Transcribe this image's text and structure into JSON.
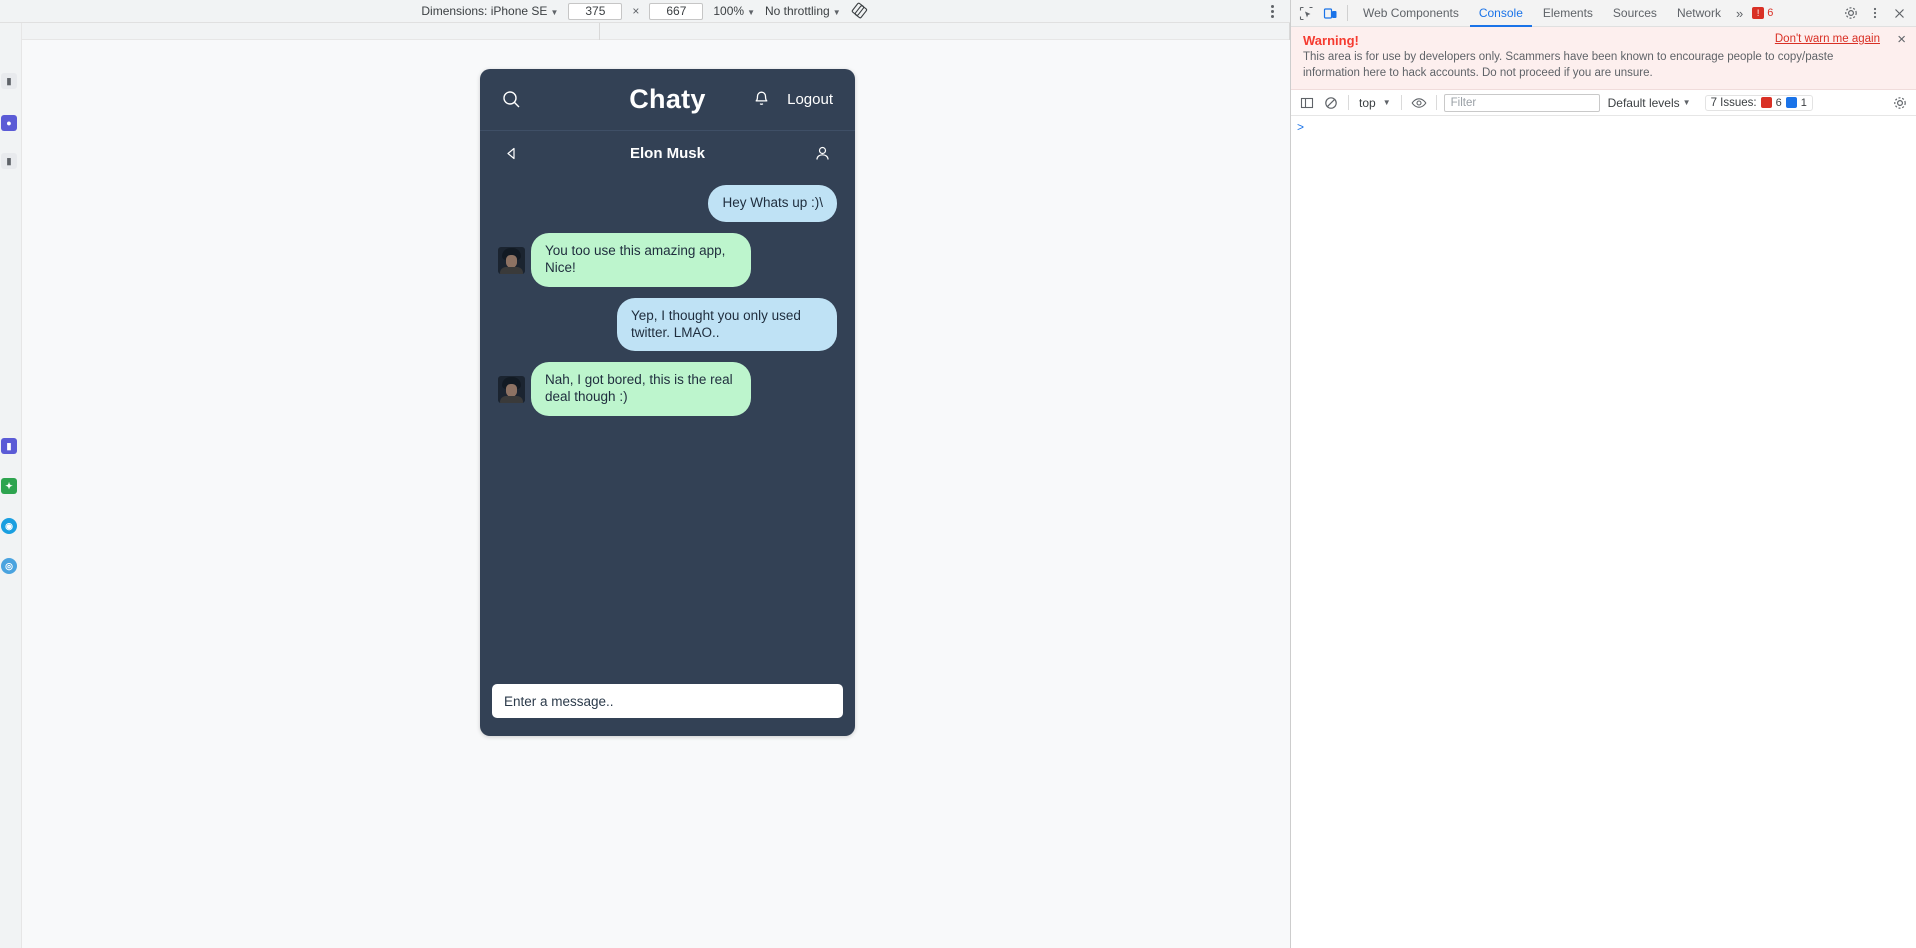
{
  "device_toolbar": {
    "dimensions_label": "Dimensions: iPhone SE",
    "width_value": "375",
    "times": "×",
    "height_value": "667",
    "zoom_label": "100%",
    "throttling_label": "No throttling",
    "rotate_icon": "rotate-device-icon",
    "more_options_icon": "kebab-menu-icon"
  },
  "app": {
    "title": "Chaty",
    "search_icon": "search-icon",
    "bell_icon": "notification-bell-icon",
    "logout_label": "Logout",
    "chat": {
      "back_icon": "back-arrow-icon",
      "contact_name": "Elon Musk",
      "profile_icon": "user-profile-icon",
      "messages": [
        {
          "text": "Hey Whats up :)\\",
          "side": "out",
          "color": "blue",
          "avatar": false,
          "nowrap": true
        },
        {
          "text": "You too use this amazing app, Nice!",
          "side": "in",
          "color": "green",
          "avatar": true,
          "nowrap": false
        },
        {
          "text": "Yep, I thought you only used twitter. LMAO..",
          "side": "out",
          "color": "blue",
          "avatar": false,
          "nowrap": false
        },
        {
          "text": "Nah, I got bored, this is the real deal though :)",
          "side": "in",
          "color": "green",
          "avatar": true,
          "nowrap": false
        }
      ]
    },
    "composer_placeholder": "Enter a message..",
    "colors": {
      "phone_bg": "#334155",
      "bubble_in": "#bdf5cd",
      "bubble_out": "#bfe2f5"
    }
  },
  "devtools": {
    "inspect_icon": "inspect-element-icon",
    "device_toggle_icon": "device-toolbar-icon",
    "tabs": [
      {
        "label": "Web Components",
        "active": false
      },
      {
        "label": "Console",
        "active": true
      },
      {
        "label": "Elements",
        "active": false
      },
      {
        "label": "Sources",
        "active": false
      },
      {
        "label": "Network",
        "active": false
      }
    ],
    "overflow_label": "»",
    "tabbar_error_count": "6",
    "settings_icon": "settings-gear-icon",
    "more_icon": "more-tools-icon",
    "close_icon": "close-devtools-icon",
    "warning": {
      "title": "Warning!",
      "body": "This area is for use by developers only. Scammers have been known to encourage people to copy/paste information here to hack accounts. Do not proceed if you are unsure.",
      "dont_warn_label": "Don't warn me again",
      "close_icon": "close-warning-icon"
    },
    "console_toolbar": {
      "sidebar_icon": "console-sidebar-icon",
      "clear_icon": "clear-console-icon",
      "context_label": "top",
      "eye_icon": "live-expression-icon",
      "filter_placeholder": "Filter",
      "levels_label": "Default levels",
      "issues_label": "7 Issues:",
      "issues_error_count": "6",
      "issues_info_count": "1",
      "settings_icon": "console-settings-icon"
    },
    "prompt_caret": ">"
  }
}
